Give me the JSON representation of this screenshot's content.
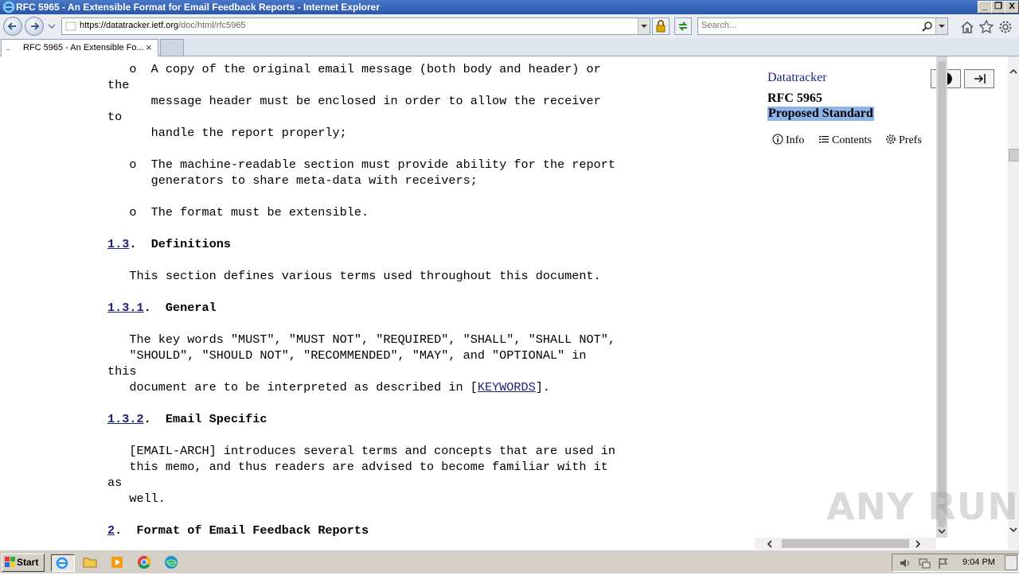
{
  "window": {
    "title": "RFC 5965 - An Extensible Format for Email Feedback Reports - Internet Explorer",
    "controls": [
      "_",
      "❐",
      "X"
    ]
  },
  "nav": {
    "url_host": "https://datatracker.ietf.org",
    "url_path": "/doc/html/rfc5965",
    "search_placeholder": "Search..."
  },
  "tab": {
    "favicon_text": "....",
    "title": "RFC 5965 - An Extensible Fo...",
    "close": "×"
  },
  "doc": {
    "l1": "   o  A copy of the original email message (both body and header) or",
    "l2": "the",
    "l3": "      message header must be enclosed in order to allow the receiver",
    "l4": "to",
    "l5": "      handle the report properly;",
    "l6": "   o  The machine-readable section must provide ability for the report",
    "l7": "      generators to share meta-data with receivers;",
    "l8": "   o  The format must be extensible.",
    "s13_num": "1.3",
    "s13_title": "Definitions",
    "s13_body": "   This section defines various terms used throughout this document.",
    "s131_num": "1.3.1",
    "s131_title": "General",
    "g1": "   The key words \"MUST\", \"MUST NOT\", \"REQUIRED\", \"SHALL\", \"SHALL NOT\",",
    "g2": "   \"SHOULD\", \"SHOULD NOT\", \"RECOMMENDED\", \"MAY\", and \"OPTIONAL\" in",
    "g3": "this",
    "g4_pre": "   document are to be interpreted as described in [",
    "g4_link": "KEYWORDS",
    "g4_post": "].",
    "s132_num": "1.3.2",
    "s132_title": "Email Specific",
    "e1": "   [EMAIL-ARCH] introduces several terms and concepts that are used in",
    "e2": "   this memo, and thus readers are advised to become familiar with it",
    "e3": "as",
    "e4": "   well.",
    "s2_num": "2",
    "s2_title": "Format of Email Feedback Reports"
  },
  "sidebar": {
    "brand": "Datatracker",
    "rfc": "RFC 5965",
    "status": "Proposed Standard",
    "tabs": {
      "info": "Info",
      "contents": "Contents",
      "prefs": "Prefs"
    }
  },
  "watermark": "ANY RUN",
  "taskbar": {
    "start": "Start",
    "clock": "9:04 PM"
  },
  "colors": {
    "link": "#1a237e",
    "status_highlight": "#8fb4e8",
    "titlebar": "#2a56a8"
  }
}
